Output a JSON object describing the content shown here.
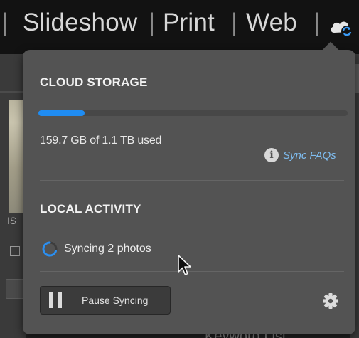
{
  "header": {
    "modules": [
      "Slideshow",
      "Print",
      "Web"
    ],
    "separator": "|",
    "cloud_icon": "cloud-sync-icon"
  },
  "popover": {
    "cloud_storage": {
      "title": "CLOUD STORAGE",
      "usage_text": "159.7 GB of 1.1 TB used",
      "usage_fraction": 0.15,
      "faq_label": "Sync FAQs",
      "faq_icon": "info-icon"
    },
    "local_activity": {
      "title": "LOCAL ACTIVITY",
      "status_text": "Syncing 2 photos",
      "status_icon": "spinner-icon"
    },
    "pause_button": {
      "label": "Pause Syncing",
      "icon": "pause-icon"
    },
    "settings_icon": "gear-icon"
  },
  "background": {
    "left_label": "IS",
    "bottom_text": "Keyword List"
  },
  "colors": {
    "accent": "#1f8cf2",
    "link": "#7fbdf0",
    "popover_bg": "#535353",
    "topbar_bg": "#121212"
  }
}
